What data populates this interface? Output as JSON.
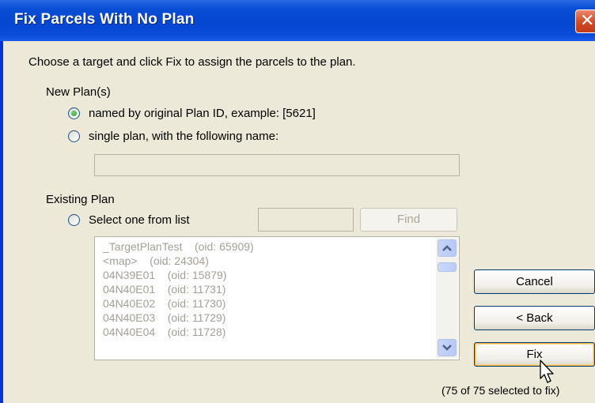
{
  "window": {
    "title": "Fix Parcels With No Plan",
    "close_glyph": "✕"
  },
  "instruction": "Choose a target and click Fix to assign the parcels to the plan.",
  "new_plans": {
    "label": "New Plan(s)",
    "option_named": "named by original Plan ID, example: [5621]",
    "option_single": "single plan, with the following name:",
    "name_value": ""
  },
  "existing_plan": {
    "label": "Existing Plan",
    "option_select": "Select one from list",
    "search_value": "",
    "find_label": "Find",
    "items": [
      {
        "name": "_TargetPlanTest",
        "oid": "(oid: 65909)"
      },
      {
        "name": "<map>",
        "oid": "(oid: 24304)"
      },
      {
        "name": "04N39E01",
        "oid": "(oid: 15879)"
      },
      {
        "name": "04N40E01",
        "oid": "(oid: 11731)"
      },
      {
        "name": "04N40E02",
        "oid": "(oid: 11730)"
      },
      {
        "name": "04N40E03",
        "oid": "(oid: 11729)"
      },
      {
        "name": "04N40E04",
        "oid": "(oid: 11728)"
      }
    ]
  },
  "buttons": {
    "cancel": "Cancel",
    "back": "< Back",
    "fix": "Fix"
  },
  "status": "(75 of 75 selected to fix)",
  "icons": {
    "scroll_up": "up-arrow-icon",
    "scroll_down": "down-arrow-icon",
    "cursor": "mouse-pointer-icon"
  },
  "colors": {
    "titlebar": "#0a4fd6",
    "close": "#d04b24",
    "dialog_bg": "#ece9d8",
    "radio_dot": "#21a121"
  }
}
